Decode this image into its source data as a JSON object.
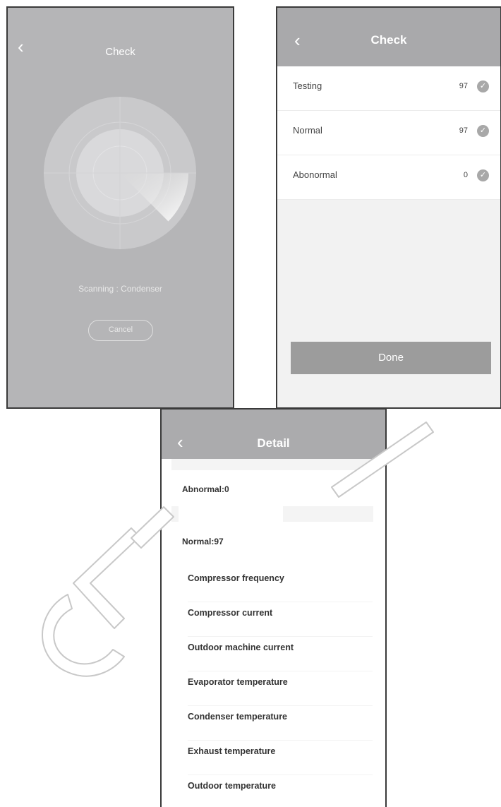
{
  "scan_screen": {
    "back_icon": "chevron-left-icon",
    "title": "Check",
    "status": "Scanning : Condenser",
    "cancel_label": "Cancel"
  },
  "check_screen": {
    "back_icon": "chevron-left-icon",
    "title": "Check",
    "rows": [
      {
        "label": "Testing",
        "value": "97",
        "icon": "check-circle-icon"
      },
      {
        "label": "Normal",
        "value": "97",
        "icon": "check-circle-icon"
      },
      {
        "label": "Abonormal",
        "value": "0",
        "icon": "check-circle-icon"
      }
    ],
    "done_label": "Done"
  },
  "detail_screen": {
    "back_icon": "chevron-left-icon",
    "title": "Detail",
    "abnormal_label": "Abnormal:0",
    "normal_label": "Normal:97",
    "items": [
      "Compressor frequency",
      "Compressor current",
      "Outdoor machine current",
      "Evaporator temperature",
      "Condenser temperature",
      "Exhaust temperature",
      "Outdoor temperature"
    ]
  },
  "watermark": {
    "text": "CLIVET",
    "color": "#c8c8c8"
  },
  "colors": {
    "scan_background": "#b5b5b7",
    "header_gray": "#a9a9ab",
    "done_button": "#9c9c9c"
  }
}
